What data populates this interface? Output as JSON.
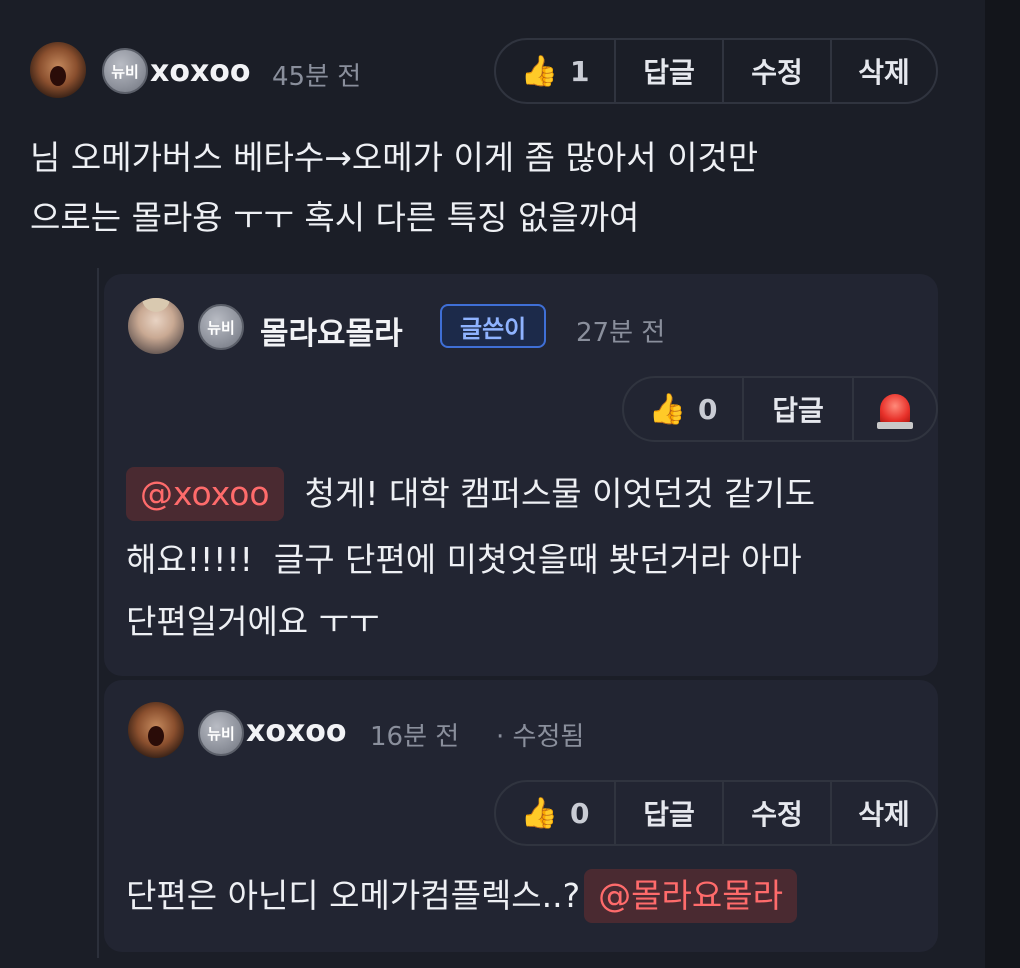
{
  "comments": [
    {
      "username": "xoxoo",
      "badge": "뉴비",
      "time": "45분 전",
      "likes": "1",
      "actions": [
        "답글",
        "수정",
        "삭제"
      ],
      "text_line1": "님 오메가버스 베타수→오메가 이게 좀 많아서 이것만",
      "text_line2": "으로는 몰라용 ㅜㅜ 혹시 다른 특징 없을까여"
    }
  ],
  "replies": [
    {
      "username": "몰라요몰라",
      "badge": "뉴비",
      "op_tag": "글쓴이",
      "time": "27분 전",
      "likes": "0",
      "reply_label": "답글",
      "mention": "@xoxoo",
      "text_line1_rest": "청게! 대학 캠퍼스물 이엇던것 같기도",
      "text_line2": "해요!!!!!  글구 단편에 미쳣엇을때 봣던거라 아마",
      "text_line3": "단편일거에요 ㅜㅜ"
    },
    {
      "username": "xoxoo",
      "badge": "뉴비",
      "time": "16분 전",
      "edited": "· 수정됨",
      "likes": "0",
      "actions": [
        "답글",
        "수정",
        "삭제"
      ],
      "text_before_mention": "단편은 아닌디 오메가컴플렉스..?",
      "mention": "@몰라요몰라"
    }
  ],
  "icons": {
    "like": "thumbs-up-icon",
    "report": "siren-icon"
  },
  "colors": {
    "background": "#1b1e27",
    "card": "#222532",
    "mention": "#ff6b6b",
    "op_tag": "#8fb3ff"
  }
}
